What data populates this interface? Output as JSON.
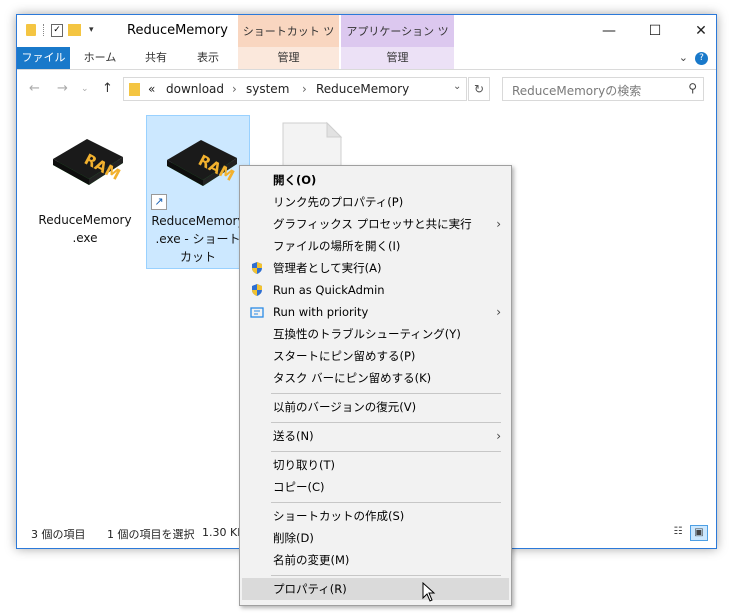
{
  "window": {
    "title": "ReduceMemory",
    "context_tabs": [
      "ショートカット ツール",
      "アプリケーション ツール"
    ],
    "controls": {
      "minimize": "—",
      "maximize": "☐",
      "close": "✕"
    }
  },
  "ribbon": {
    "file_tab": "ファイル",
    "tabs": [
      "ホーム",
      "共有",
      "表示"
    ],
    "context_manage": [
      "管理",
      "管理"
    ],
    "collapse": "⌄",
    "help": "?"
  },
  "address": {
    "back": "←",
    "forward": "→",
    "recent": "⌄",
    "up": "↑",
    "overflow": "«",
    "crumbs": [
      "download",
      "system",
      "ReduceMemory"
    ],
    "separators": [
      "›",
      "›"
    ],
    "dropdown": "⌄",
    "refresh": "↻"
  },
  "search": {
    "placeholder": "ReduceMemoryの検索",
    "icon": "⚲"
  },
  "files": [
    {
      "line1": "ReduceMemory",
      "line2": ".exe",
      "line3": "",
      "selected": false,
      "icon": "ram-icon"
    },
    {
      "line1": "ReduceMemory",
      "line2": ".exe - ショート",
      "line3": "カット",
      "selected": true,
      "icon": "ram-icon",
      "shortcut": true
    }
  ],
  "status": {
    "items_count": "3 個の項目",
    "selected": "1 個の項目を選択",
    "size": "1.30 KB"
  },
  "context_menu": {
    "items": [
      {
        "label": "開く(O)",
        "bold": true
      },
      {
        "label": "リンク先のプロパティ(P)"
      },
      {
        "label": "グラフィックス プロセッサと共に実行",
        "submenu": true
      },
      {
        "label": "ファイルの場所を開く(I)"
      },
      {
        "label": "管理者として実行(A)",
        "icon": "uac-shield-icon"
      },
      {
        "label": "Run as QuickAdmin",
        "icon": "uac-shield-icon"
      },
      {
        "label": "Run with priority",
        "icon": "priority-icon",
        "submenu": true
      },
      {
        "label": "互換性のトラブルシューティング(Y)"
      },
      {
        "label": "スタートにピン留めする(P)"
      },
      {
        "label": "タスク バーにピン留めする(K)"
      },
      {
        "label": "以前のバージョンの復元(V)"
      },
      {
        "label": "送る(N)",
        "submenu": true
      },
      {
        "label": "切り取り(T)"
      },
      {
        "label": "コピー(C)"
      },
      {
        "label": "ショートカットの作成(S)"
      },
      {
        "label": "削除(D)"
      },
      {
        "label": "名前の変更(M)"
      },
      {
        "label": "プロパティ(R)",
        "highlighted": true
      }
    ],
    "submenu_arrow": "›"
  },
  "colors": {
    "accent": "#1979ca",
    "selection": "#cce8ff",
    "ctx_tab1": "#f9d6c0",
    "ctx_tab2": "#dcc8ef"
  }
}
